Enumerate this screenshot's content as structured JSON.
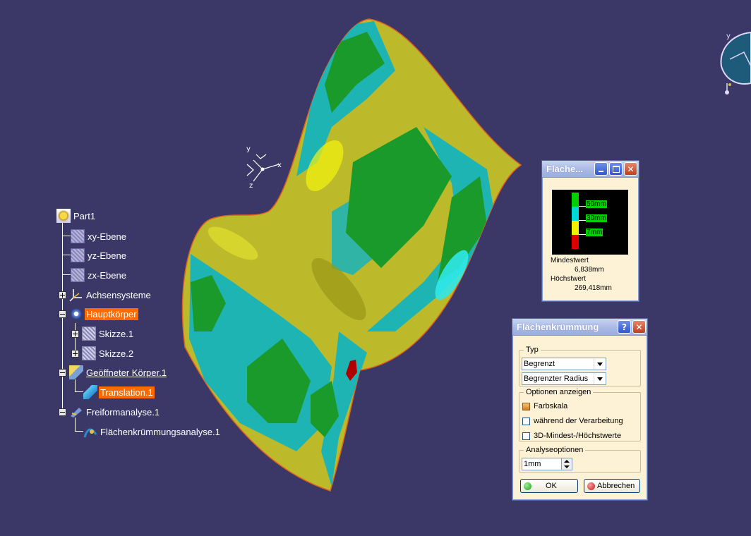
{
  "viewport": {
    "background": "#3b3868"
  },
  "axis_labels": {
    "x": "x",
    "y": "y",
    "z": "z"
  },
  "compass": {
    "label": "y"
  },
  "tree": {
    "root": "Part1",
    "xy_plane": "xy-Ebene",
    "yz_plane": "yz-Ebene",
    "zx_plane": "zx-Ebene",
    "axis_systems": "Achsensysteme",
    "main_body": "Hauptkörper",
    "sketch1": "Skizze.1",
    "sketch2": "Skizze.2",
    "open_body": "Geöffneter Körper.1",
    "translation": "Translation.1",
    "freeform": "Freiformanalyse.1",
    "curvature_analysis": "Flächenkrümmungsanalyse.1"
  },
  "legend_window": {
    "title": "Fläche...",
    "scale": [
      {
        "label": "50mm",
        "color": "#00d000"
      },
      {
        "label": "30mm",
        "color": "#00d8d8"
      },
      {
        "label": "7mm",
        "color": "#f2f200"
      },
      {
        "label": "",
        "color": "#dd0000"
      }
    ],
    "min_label": "Mindestwert",
    "min_value": "6,838mm",
    "max_label": "Höchstwert",
    "max_value": "269,418mm"
  },
  "dialog": {
    "title": "Flächenkrümmung",
    "help_label": "?",
    "type_group": "Typ",
    "type_value": "Begrenzt",
    "radius_value": "Begrenzter Radius",
    "options_group": "Optionen anzeigen",
    "color_scale": "Farbskala",
    "color_scale_checked": true,
    "during_processing": "während der Verarbeitung",
    "during_processing_checked": false,
    "min_max_3d": "3D-Mindest-/Höchstwerte",
    "min_max_3d_checked": false,
    "analysis_group": "Analyseoptionen",
    "step_value": "1mm",
    "ok_label": "OK",
    "cancel_label": "Abbrechen"
  },
  "colors": {
    "surface_yellow": "#bcba2a",
    "surface_cyan": "#1fb4b4",
    "surface_green": "#1a9a2a",
    "surface_red": "#b00000",
    "highlight": "#ff6a00"
  }
}
